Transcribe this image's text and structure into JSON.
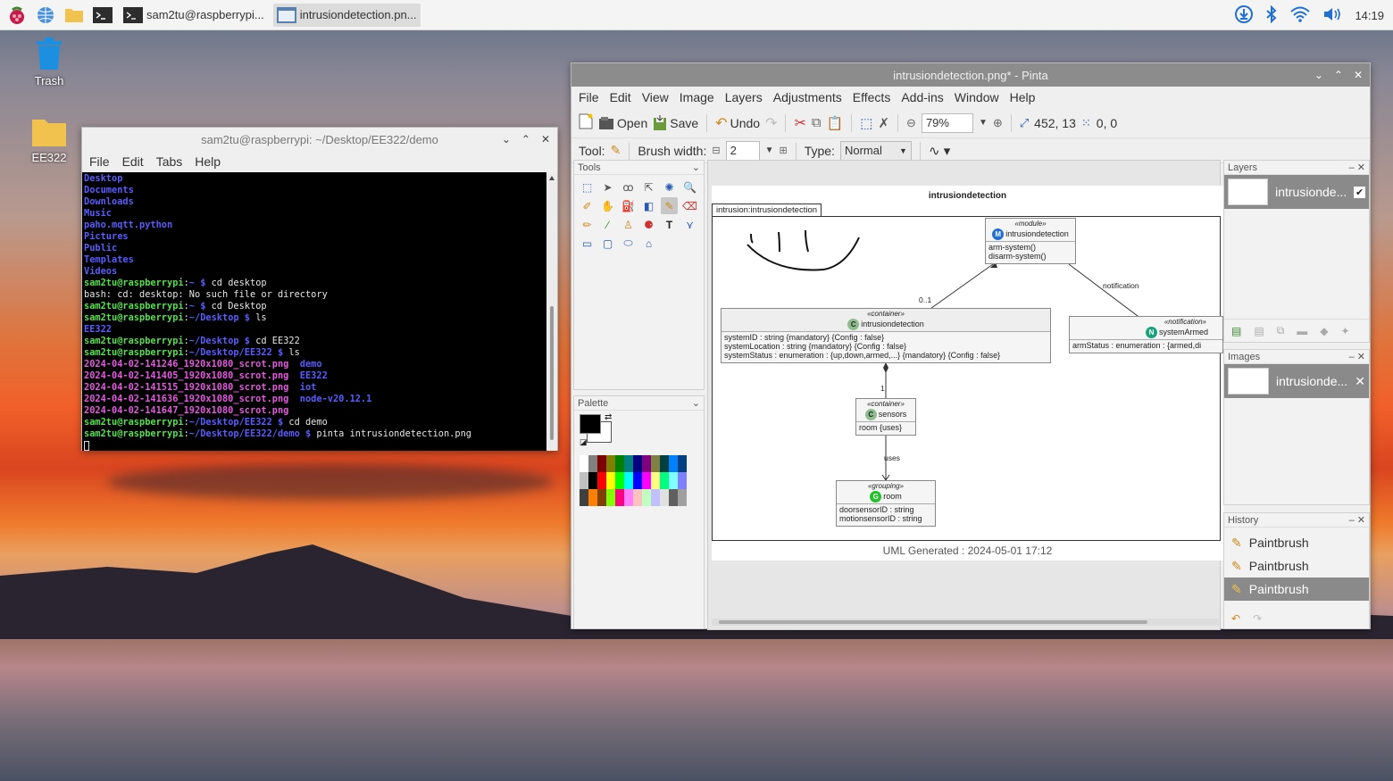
{
  "taskbar": {
    "tasks": [
      {
        "label": "sam2tu@raspberrypi..."
      },
      {
        "label": "intrusiondetection.pn..."
      }
    ],
    "clock": "14:19"
  },
  "desktop": {
    "icons": [
      {
        "label": "Trash"
      },
      {
        "label": "EE322"
      }
    ]
  },
  "terminal": {
    "title": "sam2tu@raspberrypi: ~/Desktop/EE322/demo",
    "menu": [
      "File",
      "Edit",
      "Tabs",
      "Help"
    ],
    "lines": [
      {
        "segments": [
          {
            "t": "Desktop",
            "c": "blue"
          }
        ]
      },
      {
        "segments": [
          {
            "t": "Documents",
            "c": "blue"
          }
        ]
      },
      {
        "segments": [
          {
            "t": "Downloads",
            "c": "blue"
          }
        ]
      },
      {
        "segments": [
          {
            "t": "Music",
            "c": "blue"
          }
        ]
      },
      {
        "segments": [
          {
            "t": "paho.mqtt.python",
            "c": "blue"
          }
        ]
      },
      {
        "segments": [
          {
            "t": "Pictures",
            "c": "blue"
          }
        ]
      },
      {
        "segments": [
          {
            "t": "Public",
            "c": "blue"
          }
        ]
      },
      {
        "segments": [
          {
            "t": "Templates",
            "c": "blue"
          }
        ]
      },
      {
        "segments": [
          {
            "t": "Videos",
            "c": "blue"
          }
        ]
      },
      {
        "segments": [
          {
            "t": "sam2tu@raspberrypi",
            "c": "green"
          },
          {
            "t": ":",
            "c": "white"
          },
          {
            "t": "~ $",
            "c": "blue"
          },
          {
            "t": " cd desktop",
            "c": "white"
          }
        ]
      },
      {
        "segments": [
          {
            "t": "bash: cd: desktop: No such file or directory",
            "c": "white"
          }
        ]
      },
      {
        "segments": [
          {
            "t": "sam2tu@raspberrypi",
            "c": "green"
          },
          {
            "t": ":",
            "c": "white"
          },
          {
            "t": "~ $",
            "c": "blue"
          },
          {
            "t": " cd Desktop",
            "c": "white"
          }
        ]
      },
      {
        "segments": [
          {
            "t": "sam2tu@raspberrypi",
            "c": "green"
          },
          {
            "t": ":",
            "c": "white"
          },
          {
            "t": "~/Desktop $",
            "c": "blue"
          },
          {
            "t": " ls",
            "c": "white"
          }
        ]
      },
      {
        "segments": [
          {
            "t": "EE322",
            "c": "blue"
          }
        ]
      },
      {
        "segments": [
          {
            "t": "sam2tu@raspberrypi",
            "c": "green"
          },
          {
            "t": ":",
            "c": "white"
          },
          {
            "t": "~/Desktop $",
            "c": "blue"
          },
          {
            "t": " cd EE322",
            "c": "white"
          }
        ]
      },
      {
        "segments": [
          {
            "t": "sam2tu@raspberrypi",
            "c": "green"
          },
          {
            "t": ":",
            "c": "white"
          },
          {
            "t": "~/Desktop/EE322 $",
            "c": "blue"
          },
          {
            "t": " ls",
            "c": "white"
          }
        ]
      },
      {
        "segments": [
          {
            "t": "2024-04-02-141246_1920x1080_scrot.png",
            "c": "mag"
          },
          {
            "t": "  ",
            "c": "white"
          },
          {
            "t": "demo",
            "c": "blue"
          }
        ]
      },
      {
        "segments": [
          {
            "t": "2024-04-02-141405_1920x1080_scrot.png",
            "c": "mag"
          },
          {
            "t": "  ",
            "c": "white"
          },
          {
            "t": "EE322",
            "c": "blue"
          }
        ]
      },
      {
        "segments": [
          {
            "t": "2024-04-02-141515_1920x1080_scrot.png",
            "c": "mag"
          },
          {
            "t": "  ",
            "c": "white"
          },
          {
            "t": "iot",
            "c": "blue"
          }
        ]
      },
      {
        "segments": [
          {
            "t": "2024-04-02-141636_1920x1080_scrot.png",
            "c": "mag"
          },
          {
            "t": "  ",
            "c": "white"
          },
          {
            "t": "node-v20.12.1",
            "c": "blue"
          }
        ]
      },
      {
        "segments": [
          {
            "t": "2024-04-02-141647_1920x1080_scrot.png",
            "c": "mag"
          }
        ]
      },
      {
        "segments": [
          {
            "t": "sam2tu@raspberrypi",
            "c": "green"
          },
          {
            "t": ":",
            "c": "white"
          },
          {
            "t": "~/Desktop/EE322 $",
            "c": "blue"
          },
          {
            "t": " cd demo",
            "c": "white"
          }
        ]
      },
      {
        "segments": [
          {
            "t": "sam2tu@raspberrypi",
            "c": "green"
          },
          {
            "t": ":",
            "c": "white"
          },
          {
            "t": "~/Desktop/EE322/demo $",
            "c": "blue"
          },
          {
            "t": " pinta intrusiondetection.png",
            "c": "white"
          }
        ]
      }
    ]
  },
  "pinta": {
    "title": "intrusiondetection.png* - Pinta",
    "menu": [
      "File",
      "Edit",
      "View",
      "Image",
      "Layers",
      "Adjustments",
      "Effects",
      "Add-ins",
      "Window",
      "Help"
    ],
    "toolbar": {
      "open": "Open",
      "save": "Save",
      "undo": "Undo",
      "zoom": "79%",
      "cursor_pos": "452, 13",
      "selection_size": "0, 0"
    },
    "tool_options": {
      "tool_label": "Tool:",
      "brush_width_label": "Brush width:",
      "brush_width": "2",
      "type_label": "Type:",
      "type_value": "Normal"
    },
    "panels": {
      "tools": "Tools",
      "palette": "Palette",
      "layers": "Layers",
      "images": "Images",
      "history": "History"
    },
    "layers": [
      {
        "name": "intrusionde..."
      }
    ],
    "images": [
      {
        "name": "intrusionde..."
      }
    ],
    "history": [
      {
        "label": "Paintbrush"
      },
      {
        "label": "Paintbrush"
      },
      {
        "label": "Paintbrush"
      }
    ],
    "palette_colors": [
      "#ffffff",
      "#808080",
      "#800000",
      "#808000",
      "#008000",
      "#008080",
      "#000080",
      "#800080",
      "#808040",
      "#004040",
      "#0080ff",
      "#004080",
      "#c0c0c0",
      "#000000",
      "#ff0000",
      "#ffff00",
      "#00ff00",
      "#00ffff",
      "#0000ff",
      "#ff00ff",
      "#ffff80",
      "#00ff80",
      "#80ffff",
      "#8080ff",
      "#404040",
      "#ff8000",
      "#804000",
      "#80ff00",
      "#ff0080",
      "#ff80ff",
      "#ffc0c0",
      "#c0ffc0",
      "#c0c0ff",
      "#e0e0e0",
      "#606060",
      "#a0a0a0"
    ],
    "diagram": {
      "title": "intrusiondetection",
      "tab": "intrusion:intrusiondetection",
      "footer": "UML Generated : 2024-05-01 17:12",
      "module": {
        "stereotype": "«module»",
        "name": "intrusiondetection",
        "ops": [
          "arm-system()",
          "disarm-system()"
        ]
      },
      "container": {
        "stereotype": "«container»",
        "name": "intrusiondetection",
        "attrs": [
          "systemID : string   {mandatory} {Config : false}",
          "systemLocation : string  {mandatory} {Config : false}",
          "systemStatus : enumeration : {up,down,armed,...}  {mandatory} {Config : false}"
        ]
      },
      "notification": {
        "stereotype": "«notification»",
        "name": "systemArmed",
        "attrs": [
          "armStatus : enumeration : {armed,di"
        ]
      },
      "sensors": {
        "stereotype": "«container»",
        "name": "sensors",
        "attrs": [
          "room {uses}"
        ]
      },
      "room": {
        "stereotype": "«grouping»",
        "name": "room",
        "attrs": [
          "doorsensorID : string",
          "motionsensorID : string"
        ]
      },
      "labels": {
        "mult1": "0..1",
        "notif": "notification",
        "mult2": "1",
        "uses": "uses"
      }
    }
  }
}
